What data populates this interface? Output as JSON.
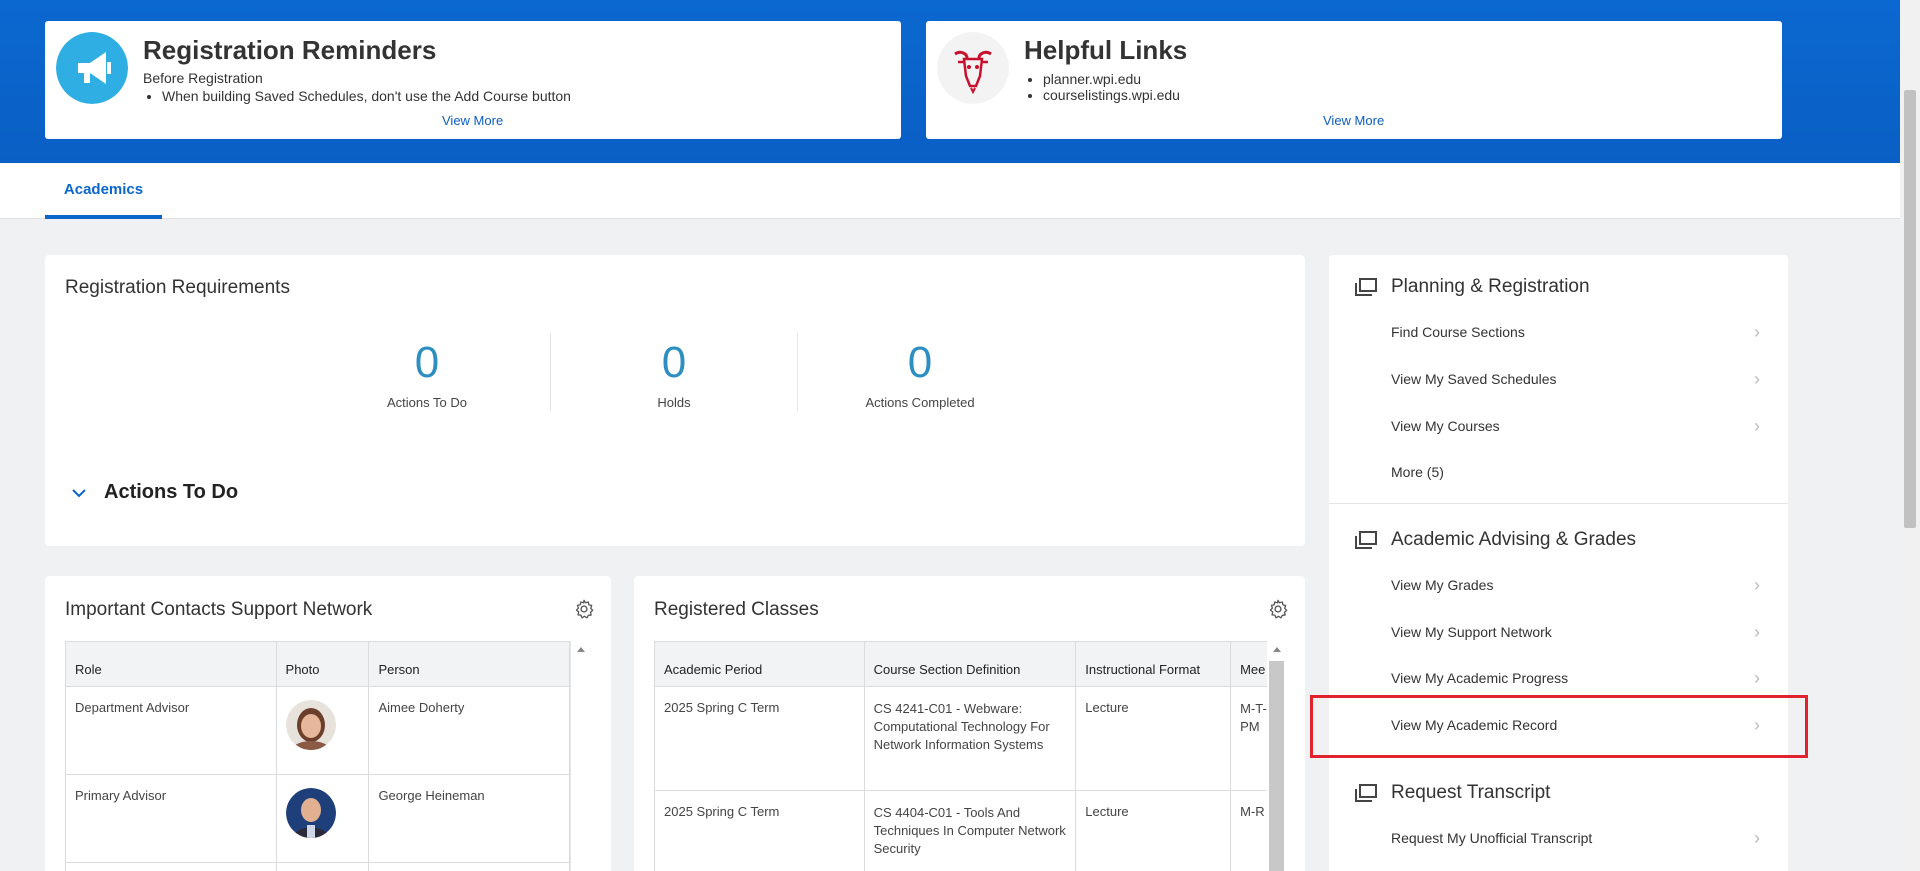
{
  "reminders": {
    "title": "Registration Reminders",
    "subtitle": "Before Registration",
    "bullets": [
      "When building Saved Schedules, don't use the Add Course button"
    ],
    "view_more": "View More"
  },
  "helpful_links": {
    "title": "Helpful Links",
    "links": [
      "planner.wpi.edu",
      "courselistings.wpi.edu"
    ],
    "view_more": "View More"
  },
  "tabs": [
    {
      "label": "Academics",
      "active": true
    }
  ],
  "registration_requirements": {
    "title": "Registration Requirements",
    "metrics": [
      {
        "value": "0",
        "label": "Actions To Do"
      },
      {
        "value": "0",
        "label": "Holds"
      },
      {
        "value": "0",
        "label": "Actions Completed"
      }
    ],
    "actions_section": "Actions To Do"
  },
  "contacts": {
    "title": "Important Contacts Support Network",
    "columns": [
      "Role",
      "Photo",
      "Person"
    ],
    "rows": [
      {
        "role": "Department Advisor",
        "person": "Aimee Doherty"
      },
      {
        "role": "Primary Advisor",
        "person": "George Heineman"
      }
    ]
  },
  "registered_classes": {
    "title": "Registered Classes",
    "columns": [
      "Academic Period",
      "Course Section Definition",
      "Instructional Format",
      "Mee"
    ],
    "rows": [
      {
        "period": "2025 Spring C Term",
        "course": "CS 4241-C01 - Webware: Computational Technology For Network Information Systems",
        "format": "Lecture",
        "meeting": "M-T-\nPM"
      },
      {
        "period": "2025 Spring C Term",
        "course": "CS 4404-C01 - Tools And Techniques In Computer Network Security",
        "format": "Lecture",
        "meeting": "M-R"
      }
    ]
  },
  "sidebar": {
    "planning": {
      "title": "Planning & Registration",
      "items": [
        "Find Course Sections",
        "View My Saved Schedules",
        "View My Courses",
        "More (5)"
      ]
    },
    "advising": {
      "title": "Academic Advising & Grades",
      "items": [
        "View My Grades",
        "View My Support Network",
        "View My Academic Progress",
        "View My Academic Record"
      ]
    },
    "transcript": {
      "title": "Request Transcript",
      "items": [
        "Request My Unofficial Transcript"
      ]
    }
  },
  "colors": {
    "banner": "#0b68d0",
    "accent": "#0b66cc",
    "metric": "#2d8fc1",
    "highlight": "#e0232c"
  }
}
